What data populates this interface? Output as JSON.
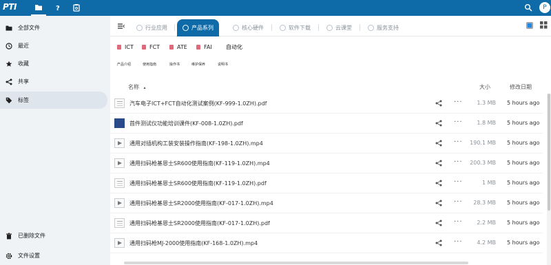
{
  "header": {
    "logo": "PTI",
    "avatar_letter": "P",
    "icons": [
      "folder-icon",
      "help-icon",
      "clipboard-icon",
      "search-icon"
    ]
  },
  "sidebar": {
    "items": [
      {
        "label": "全部文件",
        "icon": "folder-icon"
      },
      {
        "label": "最近",
        "icon": "clock-icon"
      },
      {
        "label": "收藏",
        "icon": "star-icon"
      },
      {
        "label": "共享",
        "icon": "share-icon"
      },
      {
        "label": "标签",
        "icon": "tag-icon"
      }
    ],
    "bottom": [
      {
        "label": "已删除文件",
        "icon": "trash-icon"
      },
      {
        "label": "文件设置",
        "icon": "gear-icon"
      }
    ]
  },
  "tabs": [
    {
      "label": "行业应用"
    },
    {
      "label": "产品系列"
    },
    {
      "label": "核心硬件"
    },
    {
      "label": "软件下载"
    },
    {
      "label": "云课堂"
    },
    {
      "label": "服务支持"
    }
  ],
  "subtabs": [
    "ICT",
    "FCT",
    "ATE",
    "FAI",
    "自动化"
  ],
  "docnav": [
    "产品介绍",
    "使用指南",
    "操作书",
    "维护保养",
    "说明书"
  ],
  "columns": {
    "name": "名称",
    "size": "大小",
    "modified": "修改日期",
    "sort_indicator": "▴"
  },
  "files": [
    {
      "name": "汽车电子ICT+FCT自动化测试案例(KF-999-1.0ZH).pdf",
      "type": "pdf",
      "size": "1.3 MB",
      "modified": "5 hours ago"
    },
    {
      "name": "首件测试仪功能培训课件(KF-008-1.0ZH).pdf",
      "type": "img",
      "size": "1.8 MB",
      "modified": "5 hours ago"
    },
    {
      "name": "通用对插机构工装安装操作指南(KF-198-1.0ZH).mp4",
      "type": "video",
      "size": "190.1 MB",
      "modified": "5 hours ago"
    },
    {
      "name": "通用扫码枪基恩士SR600使用指南(KF-119-1.0ZH).mp4",
      "type": "video",
      "size": "200.3 MB",
      "modified": "5 hours ago"
    },
    {
      "name": "通用扫码枪基恩士SR600使用指南(KF-119-1.0ZH).pdf",
      "type": "pdf",
      "size": "1 MB",
      "modified": "5 hours ago"
    },
    {
      "name": "通用扫码枪基恩士SR2000使用指南(KF-017-1.0ZH).mp4",
      "type": "video",
      "size": "28.3 MB",
      "modified": "5 hours ago"
    },
    {
      "name": "通用扫码枪基恩士SR2000使用指南(KF-017-1.0ZH).pdf",
      "type": "pdf",
      "size": "2.2 MB",
      "modified": "5 hours ago"
    },
    {
      "name": "通用扫码枪MJ-2000使用指南(KF-168-1.0ZH).mp4",
      "type": "video",
      "size": "4.2 MB",
      "modified": "5 hours ago"
    }
  ],
  "colors": {
    "brand": "#0f6aa8",
    "sidebar_bg": "#f0f3f6",
    "pdf_accent": "#e06a7a"
  }
}
